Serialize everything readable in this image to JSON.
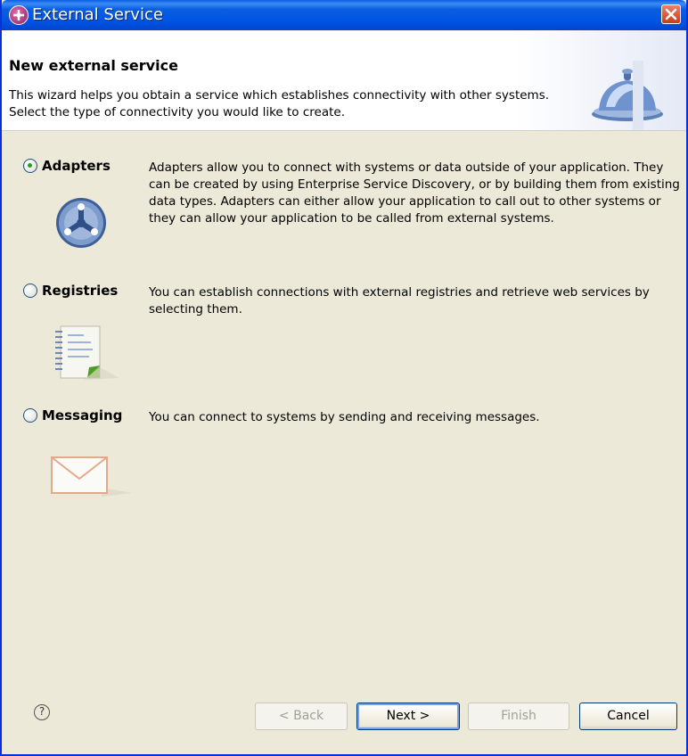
{
  "window": {
    "title": "External Service",
    "icon": "external-service-app-icon",
    "close_icon": "close-icon"
  },
  "banner": {
    "title": "New external service",
    "description": "This wizard helps you obtain a service which establishes connectivity with other systems. Select the type of connectivity you would like to create.",
    "icon": "service-bell-icon"
  },
  "options": [
    {
      "label": "Adapters",
      "selected": true,
      "description": "Adapters allow you to connect with systems or data outside of your application. They can be created by using Enterprise Service Discovery, or by building them from existing data types. Adapters can either allow your application to call out to other systems or they can allow your application to be called from external systems.",
      "icon": "adapter-icon"
    },
    {
      "label": "Registries",
      "selected": false,
      "description": "You can establish connections with external registries and retrieve web services by selecting them.",
      "icon": "registry-document-icon"
    },
    {
      "label": "Messaging",
      "selected": false,
      "description": "You can connect to systems by sending and receiving messages.",
      "icon": "envelope-icon"
    }
  ],
  "footer": {
    "help_glyph": "?",
    "back_label": "< Back",
    "next_label": "Next >",
    "finish_label": "Finish",
    "cancel_label": "Cancel"
  }
}
